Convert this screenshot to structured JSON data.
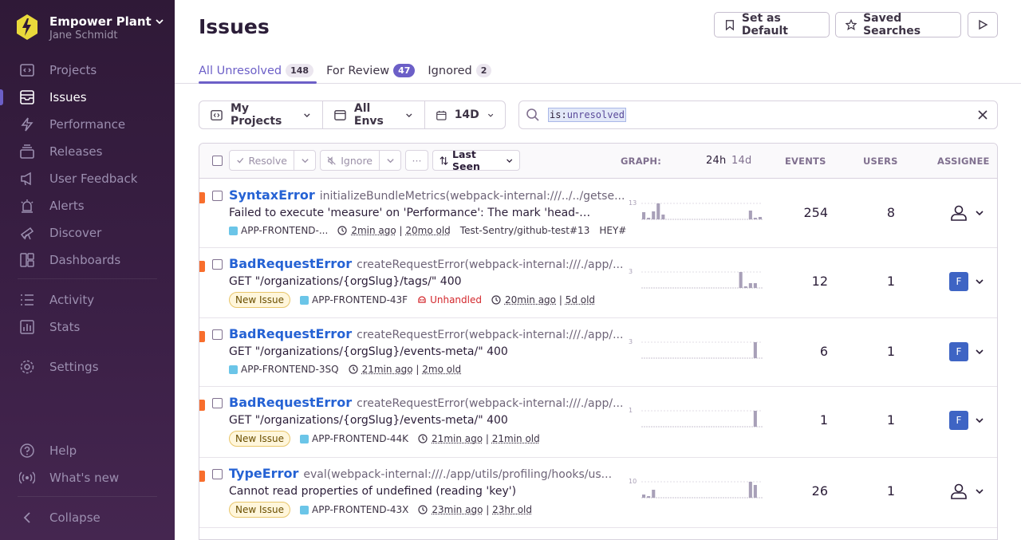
{
  "org": {
    "name": "Empower Plant",
    "user": "Jane Schmidt"
  },
  "nav": {
    "projects": "Projects",
    "issues": "Issues",
    "performance": "Performance",
    "releases": "Releases",
    "user_feedback": "User Feedback",
    "alerts": "Alerts",
    "discover": "Discover",
    "dashboards": "Dashboards",
    "activity": "Activity",
    "stats": "Stats",
    "settings": "Settings",
    "help": "Help",
    "whats_new": "What's new",
    "collapse": "Collapse"
  },
  "header": {
    "title": "Issues",
    "set_default": "Set as Default",
    "saved_searches": "Saved Searches"
  },
  "tabs": [
    {
      "label": "All Unresolved",
      "count": "148"
    },
    {
      "label": "For Review",
      "count": "47"
    },
    {
      "label": "Ignored",
      "count": "2"
    }
  ],
  "filters": {
    "projects": "My Projects",
    "envs": "All Envs",
    "period": "14D"
  },
  "search": {
    "key": "is",
    "value": "unresolved"
  },
  "table_header": {
    "resolve": "Resolve",
    "ignore": "Ignore",
    "more": "···",
    "sort": "Last Seen",
    "graph": "GRAPH:",
    "g24h": "24h",
    "g14d": "14d",
    "events": "EVENTS",
    "users": "USERS",
    "assignee": "ASSIGNEE"
  },
  "issues": [
    {
      "type": "SyntaxError",
      "culprit": "initializeBundleMetrics(webpack-internal:///../../getse...",
      "message": "Failed to execute 'measure' on 'Performance': The mark 'head-start' d...",
      "new": "",
      "project": "APP-FRONTEND-...",
      "unhandled": "",
      "last_seen": "2min ago",
      "first_seen": "20mo old",
      "extra1": "Test-Sentry/github-test#13",
      "extra2": "HEY#",
      "events": "254",
      "users": "8",
      "assignee": "",
      "graph_max": "13",
      "bars": [
        0.45,
        0.1,
        0.5,
        1.0,
        0.3,
        0,
        0,
        0,
        0,
        0,
        0,
        0,
        0,
        0,
        0,
        0,
        0,
        0,
        0,
        0,
        0,
        0,
        0.55,
        0.1,
        0.15
      ]
    },
    {
      "type": "BadRequestError",
      "culprit": "createRequestError(webpack-internal:///./app/...",
      "message": "GET \"/organizations/{orgSlug}/tags/\" 400",
      "new": "New Issue",
      "project": "APP-FRONTEND-43F",
      "unhandled": "Unhandled",
      "last_seen": "20min ago",
      "first_seen": "5d old",
      "extra1": "",
      "extra2": "",
      "events": "12",
      "users": "1",
      "assignee": "F",
      "graph_max": "3",
      "bars": [
        0,
        0,
        0,
        0,
        0,
        0,
        0,
        0,
        0,
        0,
        0,
        0,
        0,
        0,
        0,
        0,
        0,
        0,
        0,
        0,
        1.0,
        0.1,
        0.3,
        0.3,
        0
      ]
    },
    {
      "type": "BadRequestError",
      "culprit": "createRequestError(webpack-internal:///./app/...",
      "message": "GET \"/organizations/{orgSlug}/events-meta/\" 400",
      "new": "",
      "project": "APP-FRONTEND-3SQ",
      "unhandled": "",
      "last_seen": "21min ago",
      "first_seen": "2mo old",
      "extra1": "",
      "extra2": "",
      "events": "6",
      "users": "1",
      "assignee": "F",
      "graph_max": "3",
      "bars": [
        0,
        0,
        0,
        0,
        0,
        0,
        0,
        0,
        0,
        0,
        0,
        0,
        0,
        0,
        0,
        0,
        0,
        0,
        0,
        0,
        0,
        0,
        0,
        1.0,
        0
      ]
    },
    {
      "type": "BadRequestError",
      "culprit": "createRequestError(webpack-internal:///./app/...",
      "message": "GET \"/organizations/{orgSlug}/events-meta/\" 400",
      "new": "New Issue",
      "project": "APP-FRONTEND-44K",
      "unhandled": "",
      "last_seen": "21min ago",
      "first_seen": "21min old",
      "extra1": "",
      "extra2": "",
      "events": "1",
      "users": "1",
      "assignee": "F",
      "graph_max": "1",
      "bars": [
        0,
        0,
        0,
        0,
        0,
        0,
        0,
        0,
        0,
        0,
        0,
        0,
        0,
        0,
        0,
        0,
        0,
        0,
        0,
        0,
        0,
        0,
        0,
        1.0,
        0
      ]
    },
    {
      "type": "TypeError",
      "culprit": "eval(webpack-internal:///./app/utils/profiling/hooks/us...",
      "message": "Cannot read properties of undefined (reading 'key')",
      "new": "New Issue",
      "project": "APP-FRONTEND-43X",
      "unhandled": "",
      "last_seen": "23min ago",
      "first_seen": "23hr old",
      "extra1": "",
      "extra2": "",
      "events": "26",
      "users": "1",
      "assignee": "",
      "graph_max": "10",
      "bars": [
        0.2,
        0.1,
        0.5,
        0,
        0,
        0,
        0,
        0,
        0,
        0,
        0,
        0,
        0,
        0,
        0,
        0,
        0,
        0,
        0,
        0,
        0,
        0,
        1.0,
        0.8,
        0
      ]
    }
  ],
  "colors": {
    "accent": "#6c5fc7",
    "link": "#2562d4",
    "error": "#f86e2d",
    "sidebar": "#3a1f45"
  }
}
